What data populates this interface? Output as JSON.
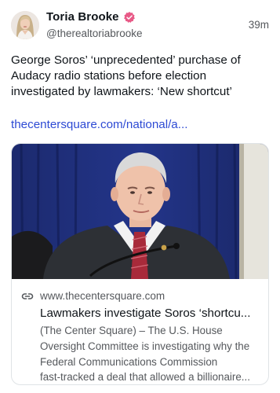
{
  "author": {
    "display_name": "Toria Brooke",
    "handle": "@therealtoriabrooke",
    "verified_icon": "verified-badge-icon",
    "avatar_icon": "avatar-photo"
  },
  "post": {
    "timestamp": "39m",
    "text": "George Soros’ ‘unprecedented’ purchase of Audacy radio stations before election investigated by lawmakers: ‘New shortcut’",
    "link_text": "thecentersquare.com/national/a..."
  },
  "card": {
    "image_icon": "hearing-photo",
    "link_icon": "link-chain-icon",
    "domain": "www.thecentersquare.com",
    "title": "Lawmakers investigate Soros ‘shortcu...",
    "description_lines": [
      "(The Center Square) – The U.S. House",
      "Oversight Committee is investigating why the",
      "Federal Communications Commission",
      "fast-tracked a deal that allowed a billionaire..."
    ]
  },
  "colors": {
    "link": "#2d4ad4",
    "verified": "#e85a87",
    "muted": "#55585c",
    "border": "#dfe3e6"
  }
}
